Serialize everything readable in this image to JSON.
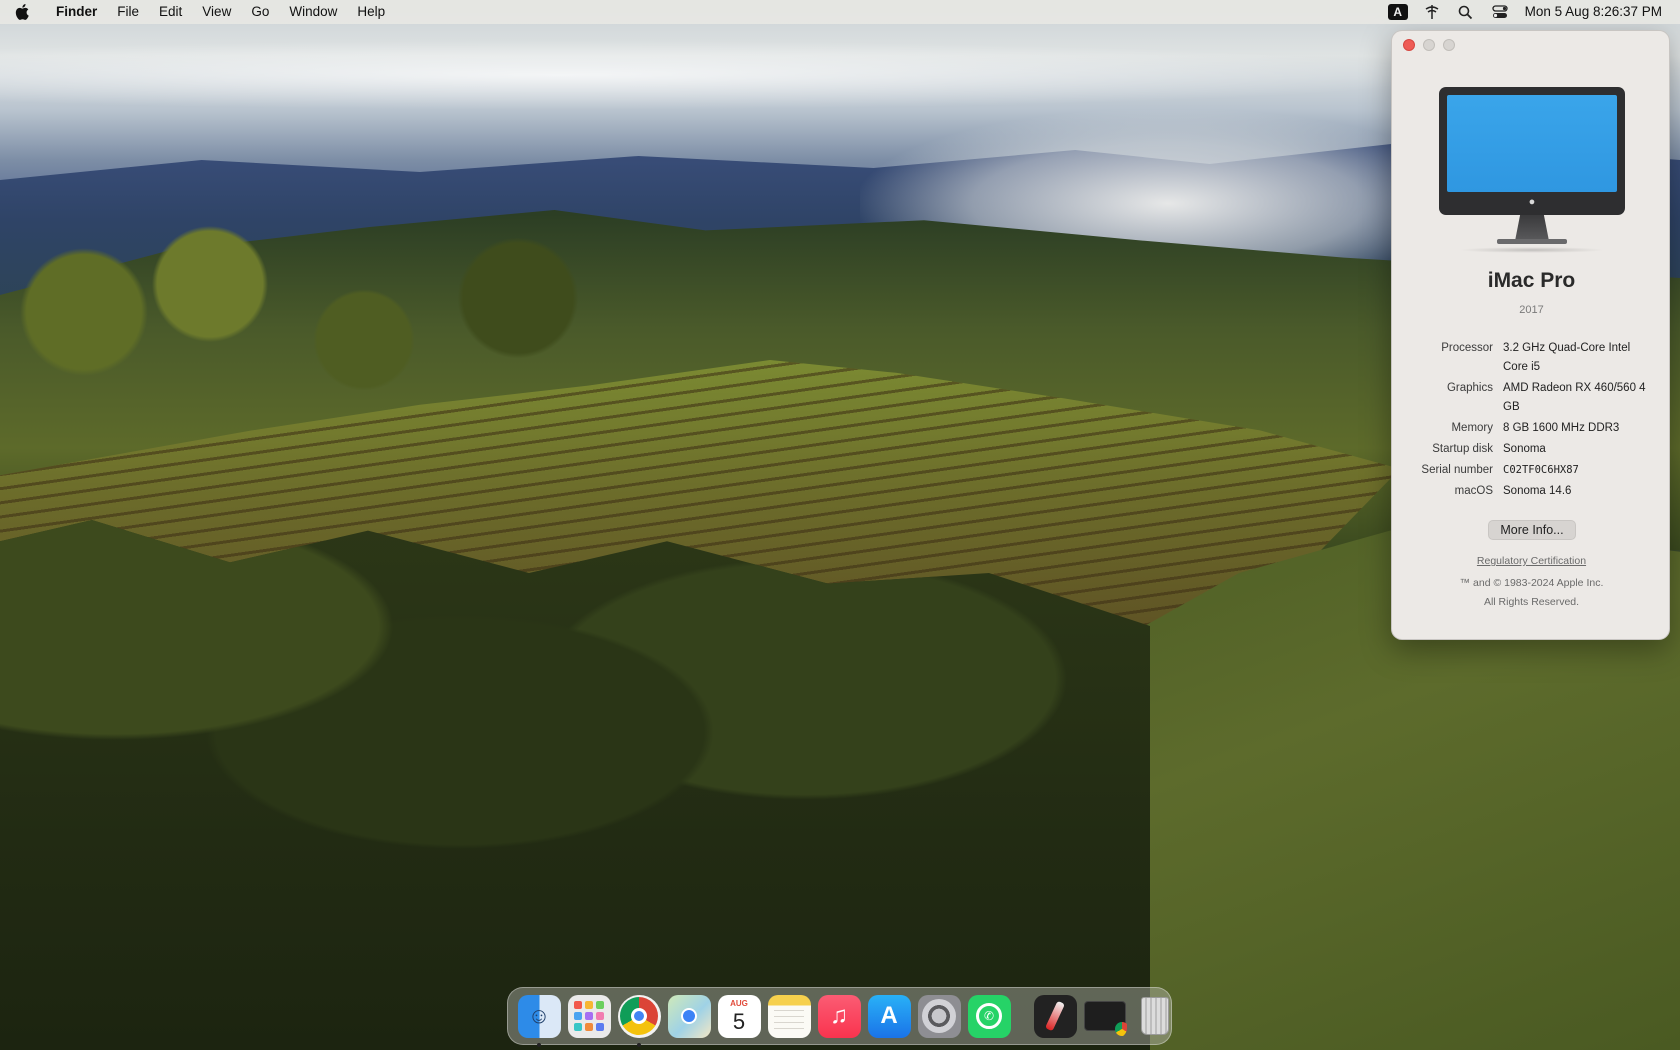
{
  "menubar": {
    "apple_icon": "apple-logo-icon",
    "items": [
      "Finder",
      "File",
      "Edit",
      "View",
      "Go",
      "Window",
      "Help"
    ],
    "input_source": "A",
    "status_icons": [
      "input-source-icon",
      "siri-icon",
      "spotlight-search-icon",
      "control-center-icon"
    ],
    "clock": "Mon 5 Aug  8:26:37 PM"
  },
  "about_window": {
    "model_name": "iMac Pro",
    "model_year": "2017",
    "specs": [
      {
        "label": "Processor",
        "value": "3.2 GHz Quad-Core Intel Core i5"
      },
      {
        "label": "Graphics",
        "value": "AMD Radeon RX 460/560 4 GB"
      },
      {
        "label": "Memory",
        "value": "8 GB 1600 MHz DDR3"
      },
      {
        "label": "Startup disk",
        "value": "Sonoma"
      },
      {
        "label": "Serial number",
        "value": "C02TF0C6HX87"
      },
      {
        "label": "macOS",
        "value": "Sonoma 14.6"
      }
    ],
    "more_info_label": "More Info...",
    "regulatory_link": "Regulatory Certification",
    "copyright_line1": "™ and © 1983-2024 Apple Inc.",
    "copyright_line2": "All Rights Reserved."
  },
  "dock": {
    "apps": [
      {
        "name": "Finder",
        "icon": "finder-icon",
        "running": true
      },
      {
        "name": "Launchpad",
        "icon": "launchpad-icon",
        "running": false
      },
      {
        "name": "Google Chrome",
        "icon": "chrome-icon",
        "running": true
      },
      {
        "name": "Maps",
        "icon": "maps-icon",
        "running": false
      },
      {
        "name": "Calendar",
        "icon": "calendar-icon",
        "running": false
      },
      {
        "name": "Notes",
        "icon": "notes-icon",
        "running": false
      },
      {
        "name": "Music",
        "icon": "music-icon",
        "running": false
      },
      {
        "name": "App Store",
        "icon": "app-store-icon",
        "running": false
      },
      {
        "name": "System Settings",
        "icon": "system-settings-icon",
        "running": false
      },
      {
        "name": "WhatsApp",
        "icon": "whatsapp-icon",
        "running": false
      }
    ],
    "extras": [
      {
        "name": "Pen app",
        "icon": "pen-icon"
      },
      {
        "name": "Chrome window",
        "icon": "chrome-window-icon"
      },
      {
        "name": "Trash",
        "icon": "trash-icon"
      }
    ],
    "calendar_month": "AUG",
    "calendar_day": "5"
  }
}
